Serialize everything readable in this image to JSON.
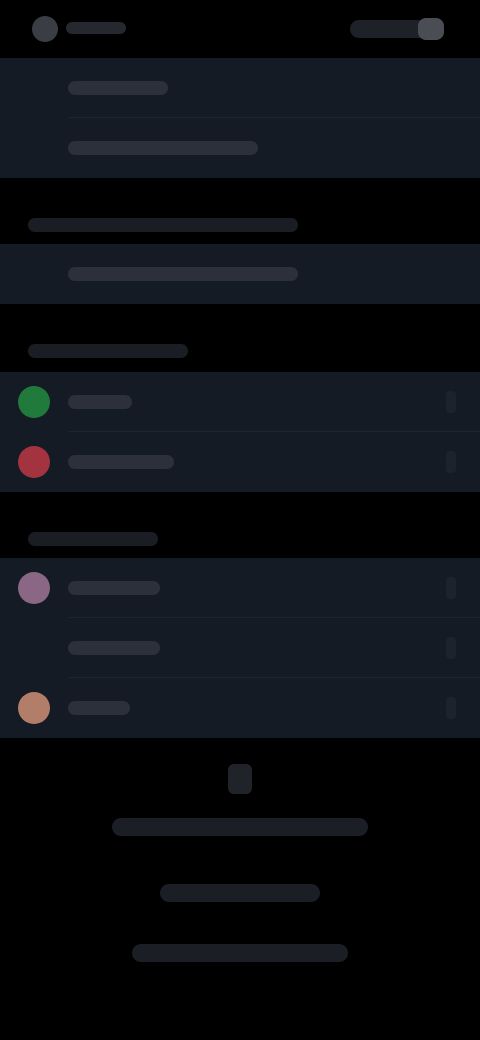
{
  "status_bar": {
    "logo_icon": "app-logo-icon",
    "right_icons": "status-icons"
  },
  "groups": {
    "top": {
      "rows": [
        {
          "label": "",
          "icon": "none"
        },
        {
          "label": "",
          "icon": "none"
        }
      ]
    },
    "middle": {
      "rows": [
        {
          "label": "",
          "icon": "none"
        }
      ]
    },
    "apps": {
      "rows": [
        {
          "label": "",
          "icon": "green-circle-icon",
          "color": "#1f7a3b"
        },
        {
          "label": "",
          "icon": "red-circle-icon",
          "color": "#a3333f"
        }
      ]
    },
    "more": {
      "rows": [
        {
          "label": "",
          "icon": "pink-circle-icon",
          "color": "#8a6784"
        },
        {
          "label": "",
          "icon": "none"
        },
        {
          "label": "",
          "icon": "peach-circle-icon",
          "color": "#b27e6a"
        }
      ]
    }
  },
  "footer": {
    "icon": "footer-icon"
  }
}
